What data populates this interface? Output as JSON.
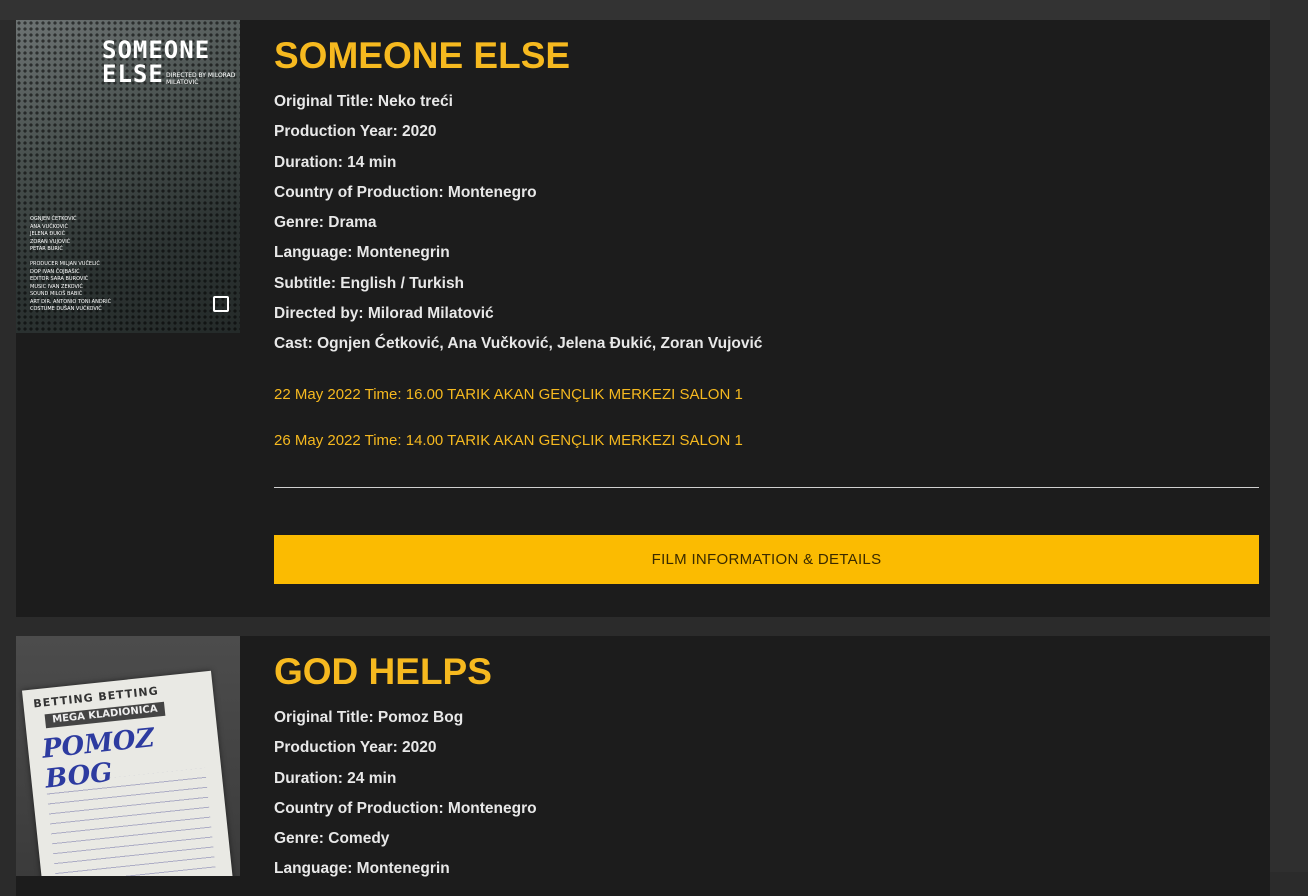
{
  "films": [
    {
      "title": "SOMEONE ELSE",
      "poster": {
        "title_line1": "SOMEONE",
        "title_line2": "ELSE",
        "subtitle": "DIRECTED BY MILORAD MILATOVIĆ",
        "credits": [
          "OGNJEN ĆETKOVIĆ",
          "ANA VUČKOVIĆ",
          "JELENA ĐUKIĆ",
          "ZORAN VUJOVIĆ",
          "PETAR BURIĆ",
          "",
          "PRODUCER MILJAN VUČELIĆ",
          "DOP IVAN ČOJBAŠIĆ",
          "EDITOR SARA BUROVIĆ",
          "MUSIC IVAN ZEKOVIĆ",
          "SOUND MILOŠ BABIĆ",
          "ART DIR. ANTONIO TONI ANDRIĆ",
          "COSTUME DUŠAN VUČKOVIĆ"
        ]
      },
      "details": [
        "Original Title: Neko treći",
        "Production Year: 2020",
        "Duration: 14 min",
        "Country of Production: Montenegro",
        "Genre: Drama",
        "Language: Montenegrin",
        "Subtitle: English / Turkish",
        "Directed by: Milorad Milatović",
        "Cast: Ognjen Ćetković, Ana Vučković, Jelena Đukić, Zoran Vujović"
      ],
      "screenings": [
        "22 May 2022 Time: 16.00 TARIK AKAN GENÇLIK MERKEZI SALON 1",
        "26 May 2022 Time: 14.00 TARIK AKAN GENÇLIK MERKEZI SALON 1"
      ],
      "button_label": "FILM INFORMATION & DETAILS"
    },
    {
      "title": "GOD HELPS",
      "poster": {
        "header": "BETTING BETTING",
        "mega": "MEGA KLADIONICA",
        "title": "POMOZ BOG"
      },
      "details": [
        "Original Title: Pomoz Bog",
        "Production Year: 2020",
        "Duration: 24 min",
        "Country of Production: Montenegro",
        "Genre: Comedy",
        "Language: Montenegrin"
      ]
    }
  ],
  "colors": {
    "accent": "#f6b91f",
    "button": "#fbbb01",
    "card_bg": "#1c1c1c",
    "page_bg": "#2b2b2b"
  }
}
